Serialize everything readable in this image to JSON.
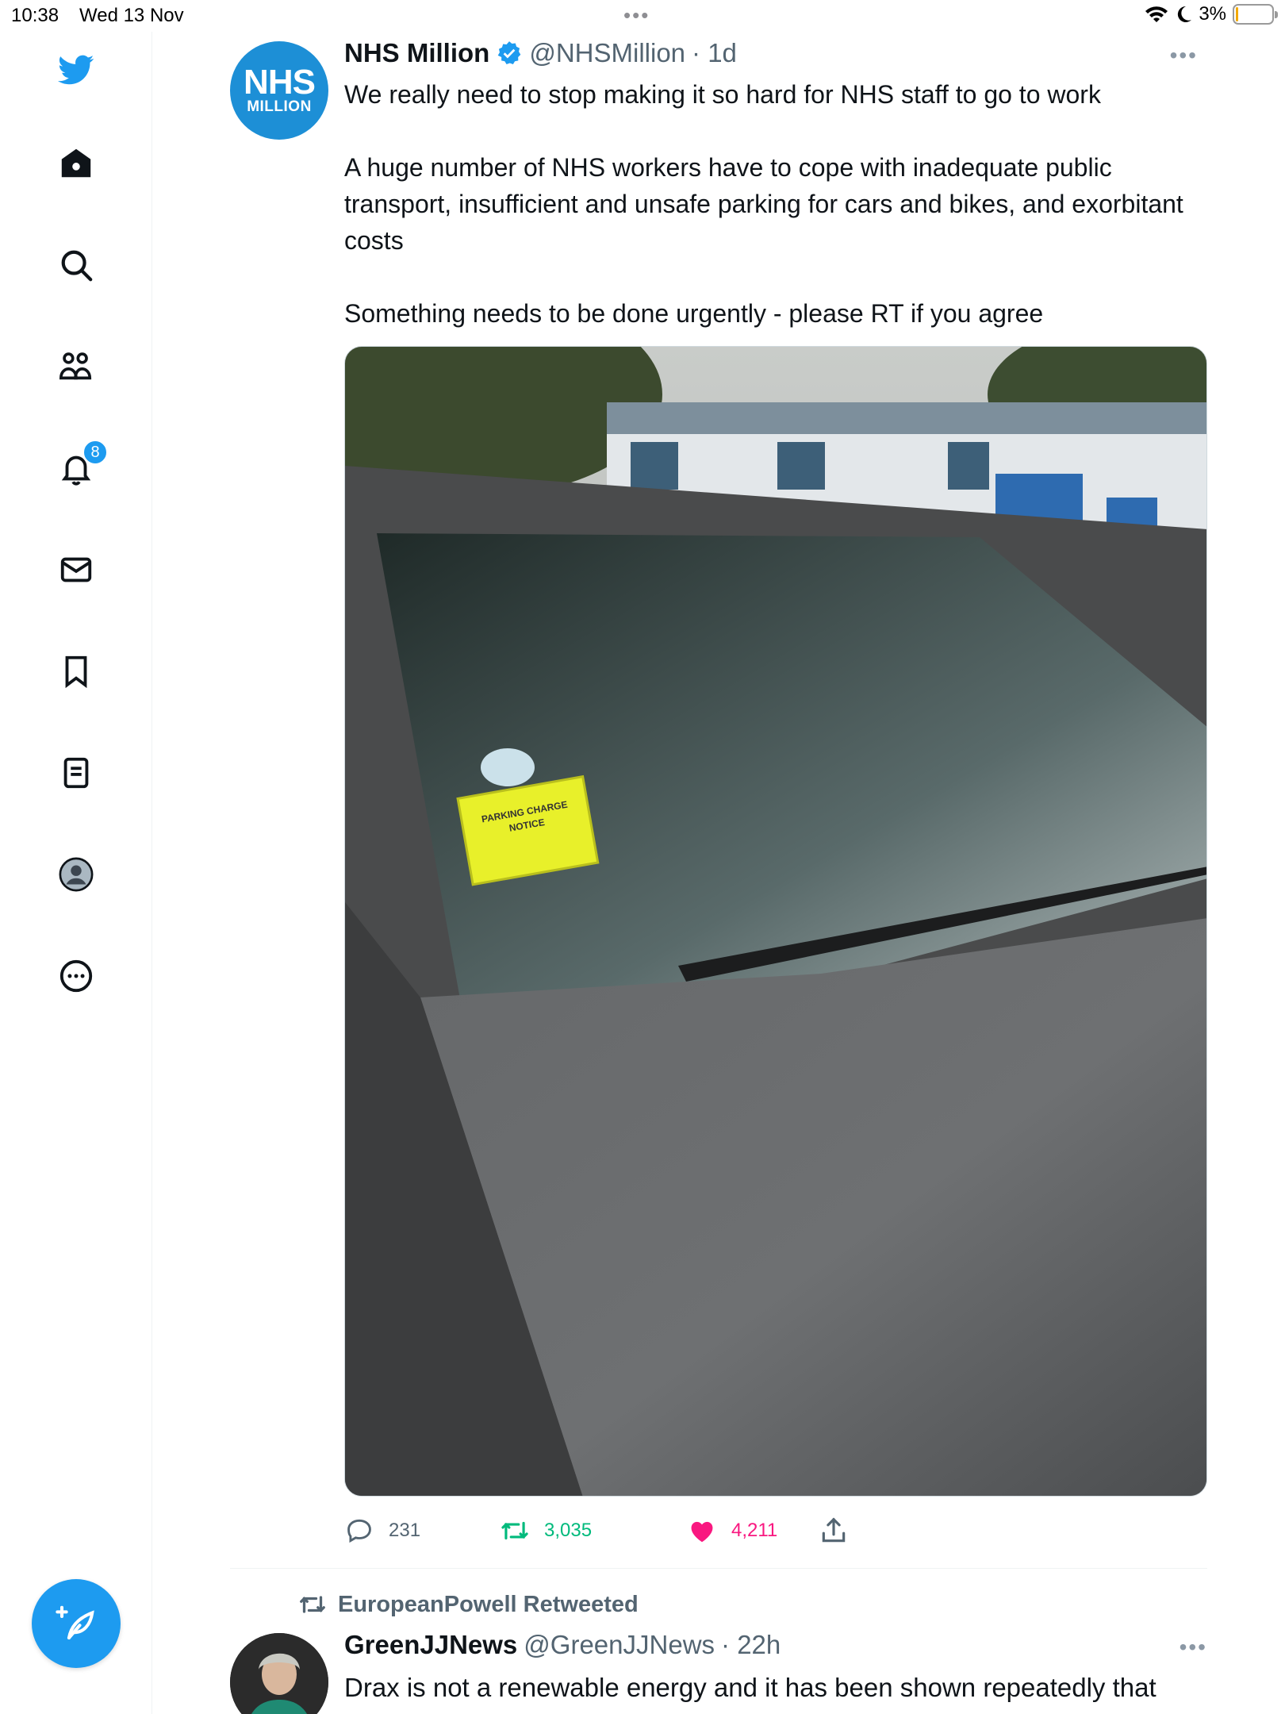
{
  "status_bar": {
    "time": "10:38",
    "date": "Wed 13 Nov",
    "battery": "3%",
    "battery_level": 0.03,
    "battery_color": "#f2a900"
  },
  "sidebar": {
    "logo": "twitter-bird-icon",
    "items": [
      {
        "icon": "home-icon"
      },
      {
        "icon": "search-icon"
      },
      {
        "icon": "communities-icon"
      },
      {
        "icon": "notifications-icon",
        "badge": "8"
      },
      {
        "icon": "messages-icon"
      },
      {
        "icon": "bookmarks-icon"
      },
      {
        "icon": "lists-icon"
      },
      {
        "icon": "profile-icon"
      },
      {
        "icon": "more-icon"
      }
    ],
    "compose_icon": "compose-tweet-icon"
  },
  "tweet": {
    "avatar_line1": "NHS",
    "avatar_line2": "MILLION",
    "name": "NHS Million",
    "handle": "@NHSMillion",
    "time": "· 1d",
    "text": "We really need to stop making it so hard for NHS staff to go to work\n\nA huge number of NHS workers have to cope with inadequate public transport, insufficient and unsafe parking for cars and bikes, and exorbitant costs\n\nSomething needs to be done urgently - please RT if you agree",
    "media_notice_line1": "PARKING CHARGE",
    "media_notice_line2": "NOTICE",
    "replies": "231",
    "retweets": "3,035",
    "likes": "4,211",
    "retweet_color": "#00ba7c",
    "like_color": "#f91880"
  },
  "next_tweet": {
    "retweeted_by": "EuropeanPowell Retweeted",
    "name": "GreenJJNews",
    "handle": "@GreenJJNews",
    "time": "· 22h",
    "text": "Drax is not a renewable energy and it has been shown repeatedly that"
  }
}
